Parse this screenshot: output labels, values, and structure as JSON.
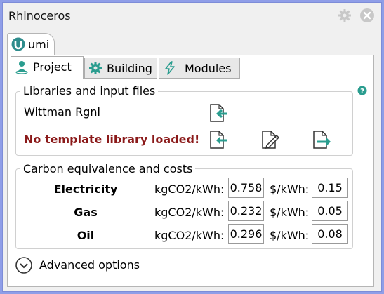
{
  "window": {
    "title": "Rhinoceros"
  },
  "panel_tab": {
    "label": "umi"
  },
  "tabs": [
    {
      "label": "Project",
      "active": true
    },
    {
      "label": "Building",
      "active": false
    },
    {
      "label": "Modules",
      "active": false
    }
  ],
  "libraries": {
    "title": "Libraries and input files",
    "weather_file": "Wittman Rgnl",
    "template_status": "No template library loaded!"
  },
  "carbon": {
    "title": "Carbon equivalence and costs",
    "rows": [
      {
        "fuel": "Electricity",
        "unit1": "kgCO2/kWh:",
        "co2": "0.758",
        "unit2": "$/kWh:",
        "cost": "0.15"
      },
      {
        "fuel": "Gas",
        "unit1": "kgCO2/kWh:",
        "co2": "0.232",
        "unit2": "$/kWh:",
        "cost": "0.05"
      },
      {
        "fuel": "Oil",
        "unit1": "kgCO2/kWh:",
        "co2": "0.296",
        "unit2": "$/kWh:",
        "cost": "0.08"
      }
    ]
  },
  "advanced": {
    "label": "Advanced options"
  },
  "colors": {
    "accent": "#2a9d8f",
    "warning": "#8b1a1a",
    "background": "#8f9ee8"
  },
  "icons": [
    "gear-icon",
    "close-icon",
    "umi-logo-icon",
    "person-icon",
    "gear-tab-icon",
    "lightning-icon",
    "help-icon",
    "import-file-icon",
    "edit-file-icon",
    "export-file-icon",
    "chevron-down-circle-icon"
  ]
}
